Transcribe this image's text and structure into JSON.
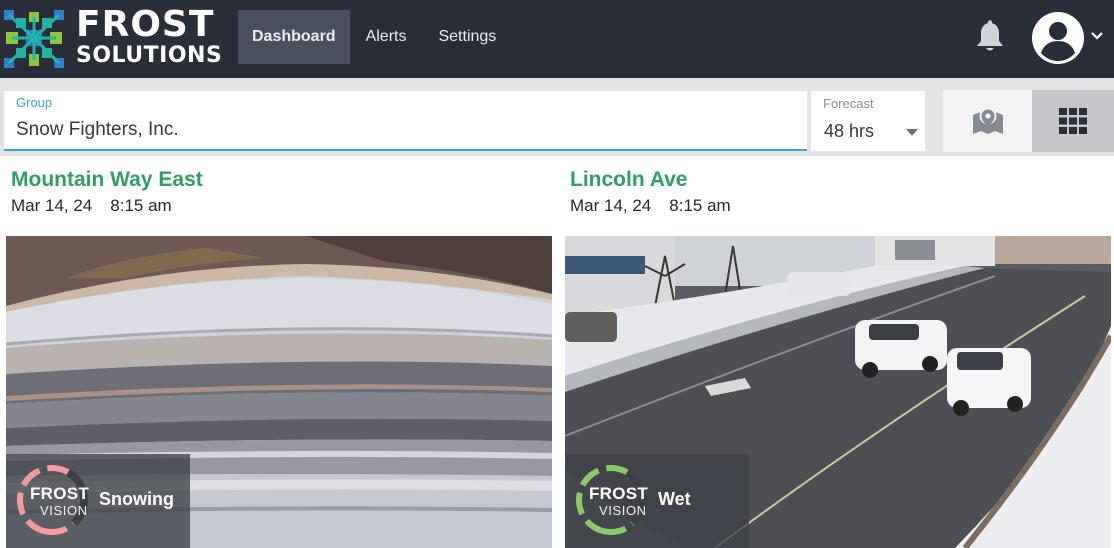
{
  "brand": {
    "line1": "FROST",
    "line2": "SOLUTIONS",
    "colors": {
      "blue": "#2f7fd0",
      "teal": "#1fb5a9",
      "green": "#8cc63f",
      "navy": "#2a2e38"
    }
  },
  "nav": {
    "items": [
      {
        "label": "Dashboard",
        "active": true
      },
      {
        "label": "Alerts",
        "active": false
      },
      {
        "label": "Settings",
        "active": false
      }
    ]
  },
  "header_icons": {
    "notifications": "bell-icon",
    "account": "user-circle-icon",
    "account_menu": "chevron-down-icon"
  },
  "filters": {
    "group": {
      "label": "Group",
      "value": "Snow Fighters, Inc."
    },
    "forecast": {
      "label": "Forecast",
      "value": "48 hrs"
    }
  },
  "view_toggle": {
    "options": [
      {
        "icon": "map-icon",
        "selected": false
      },
      {
        "icon": "grid-icon",
        "selected": true
      }
    ]
  },
  "cameras": [
    {
      "name": "Mountain Way East",
      "date": "Mar 14, 24",
      "time": "8:15 am",
      "badge": {
        "brand": "FROST",
        "sub": "VISION",
        "status": "Snowing",
        "ring_color": "#f29aa0"
      }
    },
    {
      "name": "Lincoln Ave",
      "date": "Mar 14, 24",
      "time": "8:15 am",
      "badge": {
        "brand": "FROST",
        "sub": "VISION",
        "status": "Wet",
        "ring_color": "#8cc96a"
      }
    }
  ],
  "colors": {
    "accent_title": "#2f9e67",
    "field_underline": "#3aa0e0",
    "topbar": "#2a2e38"
  }
}
